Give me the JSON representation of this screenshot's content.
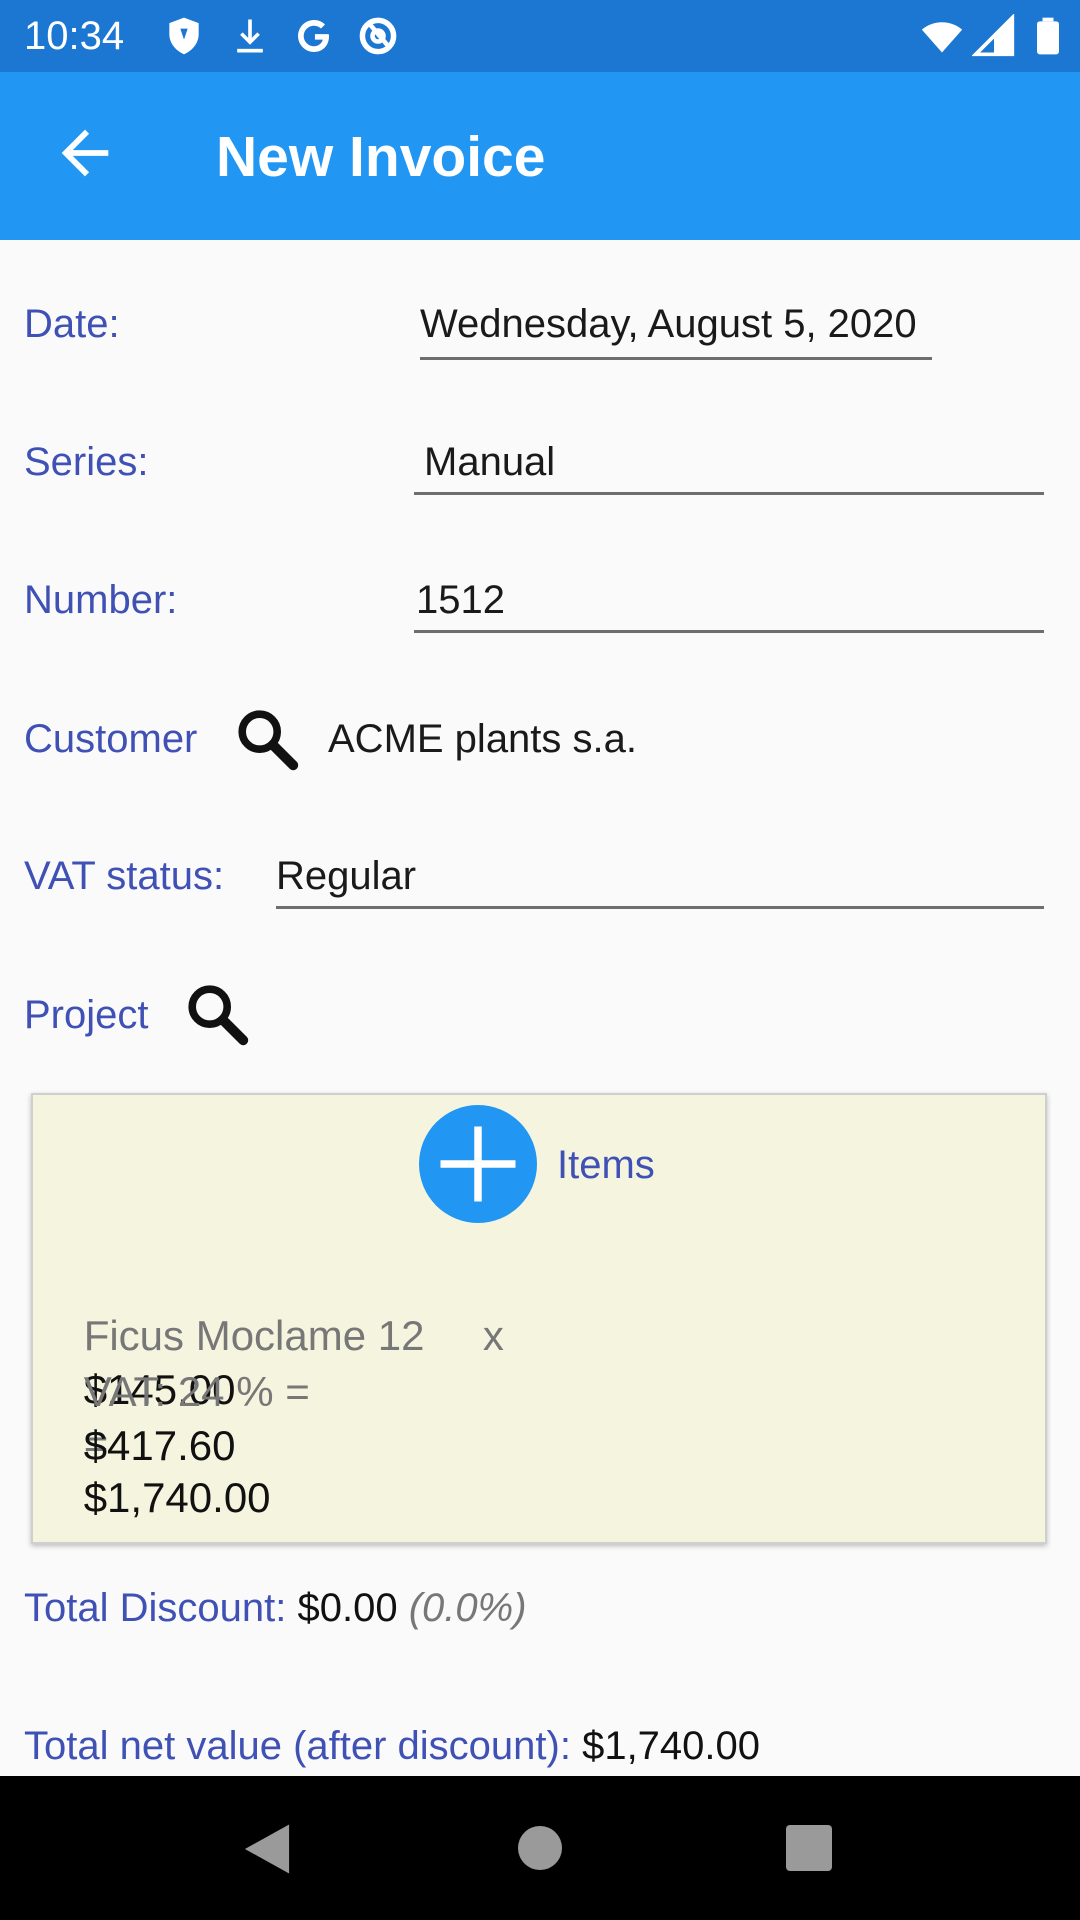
{
  "status_bar": {
    "time": "10:34",
    "icons_left": [
      "shield-icon",
      "download-icon",
      "google-icon",
      "at-icon"
    ],
    "icons_right": [
      "wifi-icon",
      "signal-icon",
      "battery-icon"
    ]
  },
  "app_bar": {
    "title": "New Invoice",
    "back_icon": "arrow-back-icon"
  },
  "form": {
    "date_label": "Date:",
    "date_value": "Wednesday, August 5, 2020",
    "series_label": "Series:",
    "series_value": "Manual",
    "number_label": "Number:",
    "number_value": "1512",
    "customer_label": "Customer",
    "customer_value": "ACME plants s.a.",
    "vat_label": "VAT status:",
    "vat_value": "Regular",
    "project_label": "Project"
  },
  "items": {
    "label": "Items",
    "add_icon": "plus-icon",
    "lines": [
      {
        "name": "Ficus Moclame 12",
        "times": "x",
        "price": "$145.00",
        "equals": "=",
        "total": "$1,740.00",
        "vat_prefix": "VAT: 24 % =",
        "vat_amount": "$417.60"
      }
    ]
  },
  "totals": {
    "discount_label": "Total Discount:",
    "discount_value": "$0.00",
    "discount_pct": "(0.0%)",
    "net_label": "Total net value (after discount):",
    "net_value": "$1,740.00"
  },
  "colors": {
    "status_bar": "#1b77d2",
    "app_bar": "#2196f3",
    "label": "#3f51b5",
    "card": "#f5f5df"
  }
}
